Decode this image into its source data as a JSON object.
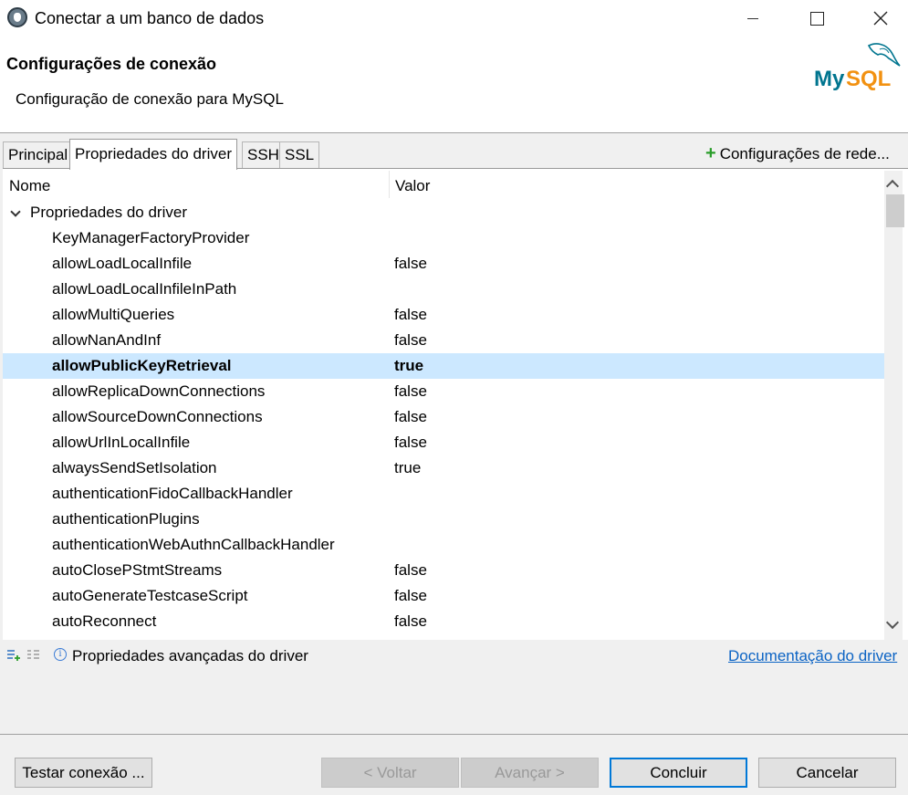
{
  "window": {
    "title": "Conectar a um banco de dados"
  },
  "header": {
    "title": "Configurações de conexão",
    "subtitle": "Configuração de conexão para MySQL",
    "logo_text": "MySQL"
  },
  "tabs": [
    {
      "label": "Principal",
      "active": false
    },
    {
      "label": "Propriedades do driver",
      "active": true
    },
    {
      "label": "SSH",
      "active": false
    },
    {
      "label": "SSL",
      "active": false
    }
  ],
  "network_settings_label": "Configurações de rede...",
  "grid": {
    "col_name": "Nome",
    "col_value": "Valor",
    "group_label": "Propriedades do driver",
    "rows": [
      {
        "name": "KeyManagerFactoryProvider",
        "value": ""
      },
      {
        "name": "allowLoadLocalInfile",
        "value": "false"
      },
      {
        "name": "allowLoadLocalInfileInPath",
        "value": ""
      },
      {
        "name": "allowMultiQueries",
        "value": "false"
      },
      {
        "name": "allowNanAndInf",
        "value": "false"
      },
      {
        "name": "allowPublicKeyRetrieval",
        "value": "true",
        "selected": true
      },
      {
        "name": "allowReplicaDownConnections",
        "value": "false"
      },
      {
        "name": "allowSourceDownConnections",
        "value": "false"
      },
      {
        "name": "allowUrlInLocalInfile",
        "value": "false"
      },
      {
        "name": "alwaysSendSetIsolation",
        "value": "true"
      },
      {
        "name": "authenticationFidoCallbackHandler",
        "value": ""
      },
      {
        "name": "authenticationPlugins",
        "value": ""
      },
      {
        "name": "authenticationWebAuthnCallbackHandler",
        "value": ""
      },
      {
        "name": "autoClosePStmtStreams",
        "value": "false"
      },
      {
        "name": "autoGenerateTestcaseScript",
        "value": "false"
      },
      {
        "name": "autoReconnect",
        "value": "false"
      }
    ]
  },
  "toolbar": {
    "advanced_label": "Propriedades avançadas do driver",
    "doc_link": "Documentação do driver"
  },
  "buttons": {
    "test": "Testar conexão ...",
    "back": "< Voltar",
    "next": "Avançar >",
    "finish": "Concluir",
    "cancel": "Cancelar"
  }
}
